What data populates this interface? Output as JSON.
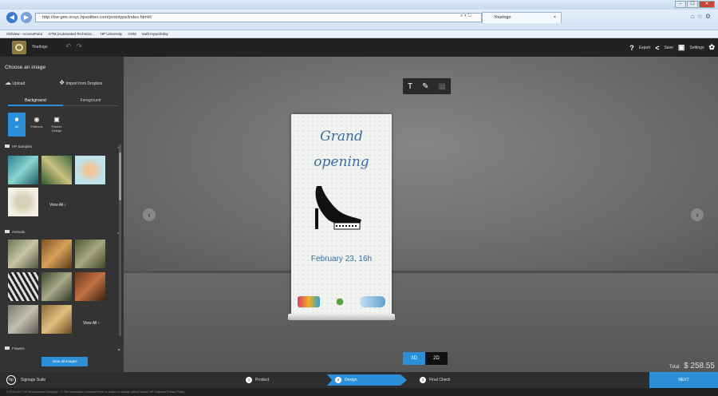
{
  "browser": {
    "address": "http://ise-gmr.orsyc.hpsolibet.com/prototype/index.html#/",
    "tab_title": "Yourlogo",
    "favorites": [
      "OldView - AccessPoint",
      "GTM (Automated Technicie...",
      "HP University",
      "GSM",
      "swift.myworkday"
    ],
    "win_buttons": [
      "–",
      "☐",
      "✕"
    ]
  },
  "app": {
    "name": "Yourlogo",
    "top_actions": {
      "help": "?",
      "export": "Export",
      "save": "Save",
      "settings": "Settings"
    }
  },
  "sidebar": {
    "title": "Choose an image",
    "upload": "Upload",
    "dropbox": "Import from Dropbox",
    "tabs": [
      "Background",
      "Foreground"
    ],
    "types": [
      {
        "label": "All",
        "icon": "folder-icon"
      },
      {
        "label": "Patterns",
        "icon": "pattern-icon"
      },
      {
        "label": "Pattern Design",
        "icon": "pattern-design-icon"
      }
    ],
    "sections": [
      {
        "title": "HP Samples",
        "view_all": "View All"
      },
      {
        "title": "Animals",
        "view_all": "View All"
      },
      {
        "title": "Flowers"
      }
    ],
    "view_images": "View all images"
  },
  "canvas": {
    "banner_title_1": "Grand",
    "banner_title_2": "opening",
    "banner_date": "February 23, 16h",
    "toggle": [
      "3D",
      "2D"
    ],
    "total_label": "Total:",
    "total_value": "$ 258.55"
  },
  "bottom": {
    "brand": "Signage Suite",
    "steps": [
      {
        "num": "1",
        "label": "Product"
      },
      {
        "num": "2",
        "label": "Design"
      },
      {
        "num": "3",
        "label": "Final Check"
      }
    ],
    "next": "NEXT",
    "footer": "© 2015-2017 HP Development Company, L.P. The information contained herein is subject to change without notice. HP Customer Privacy Policy"
  },
  "colors": {
    "accent": "#2b8fd8",
    "banner_text": "#3a6da0"
  }
}
